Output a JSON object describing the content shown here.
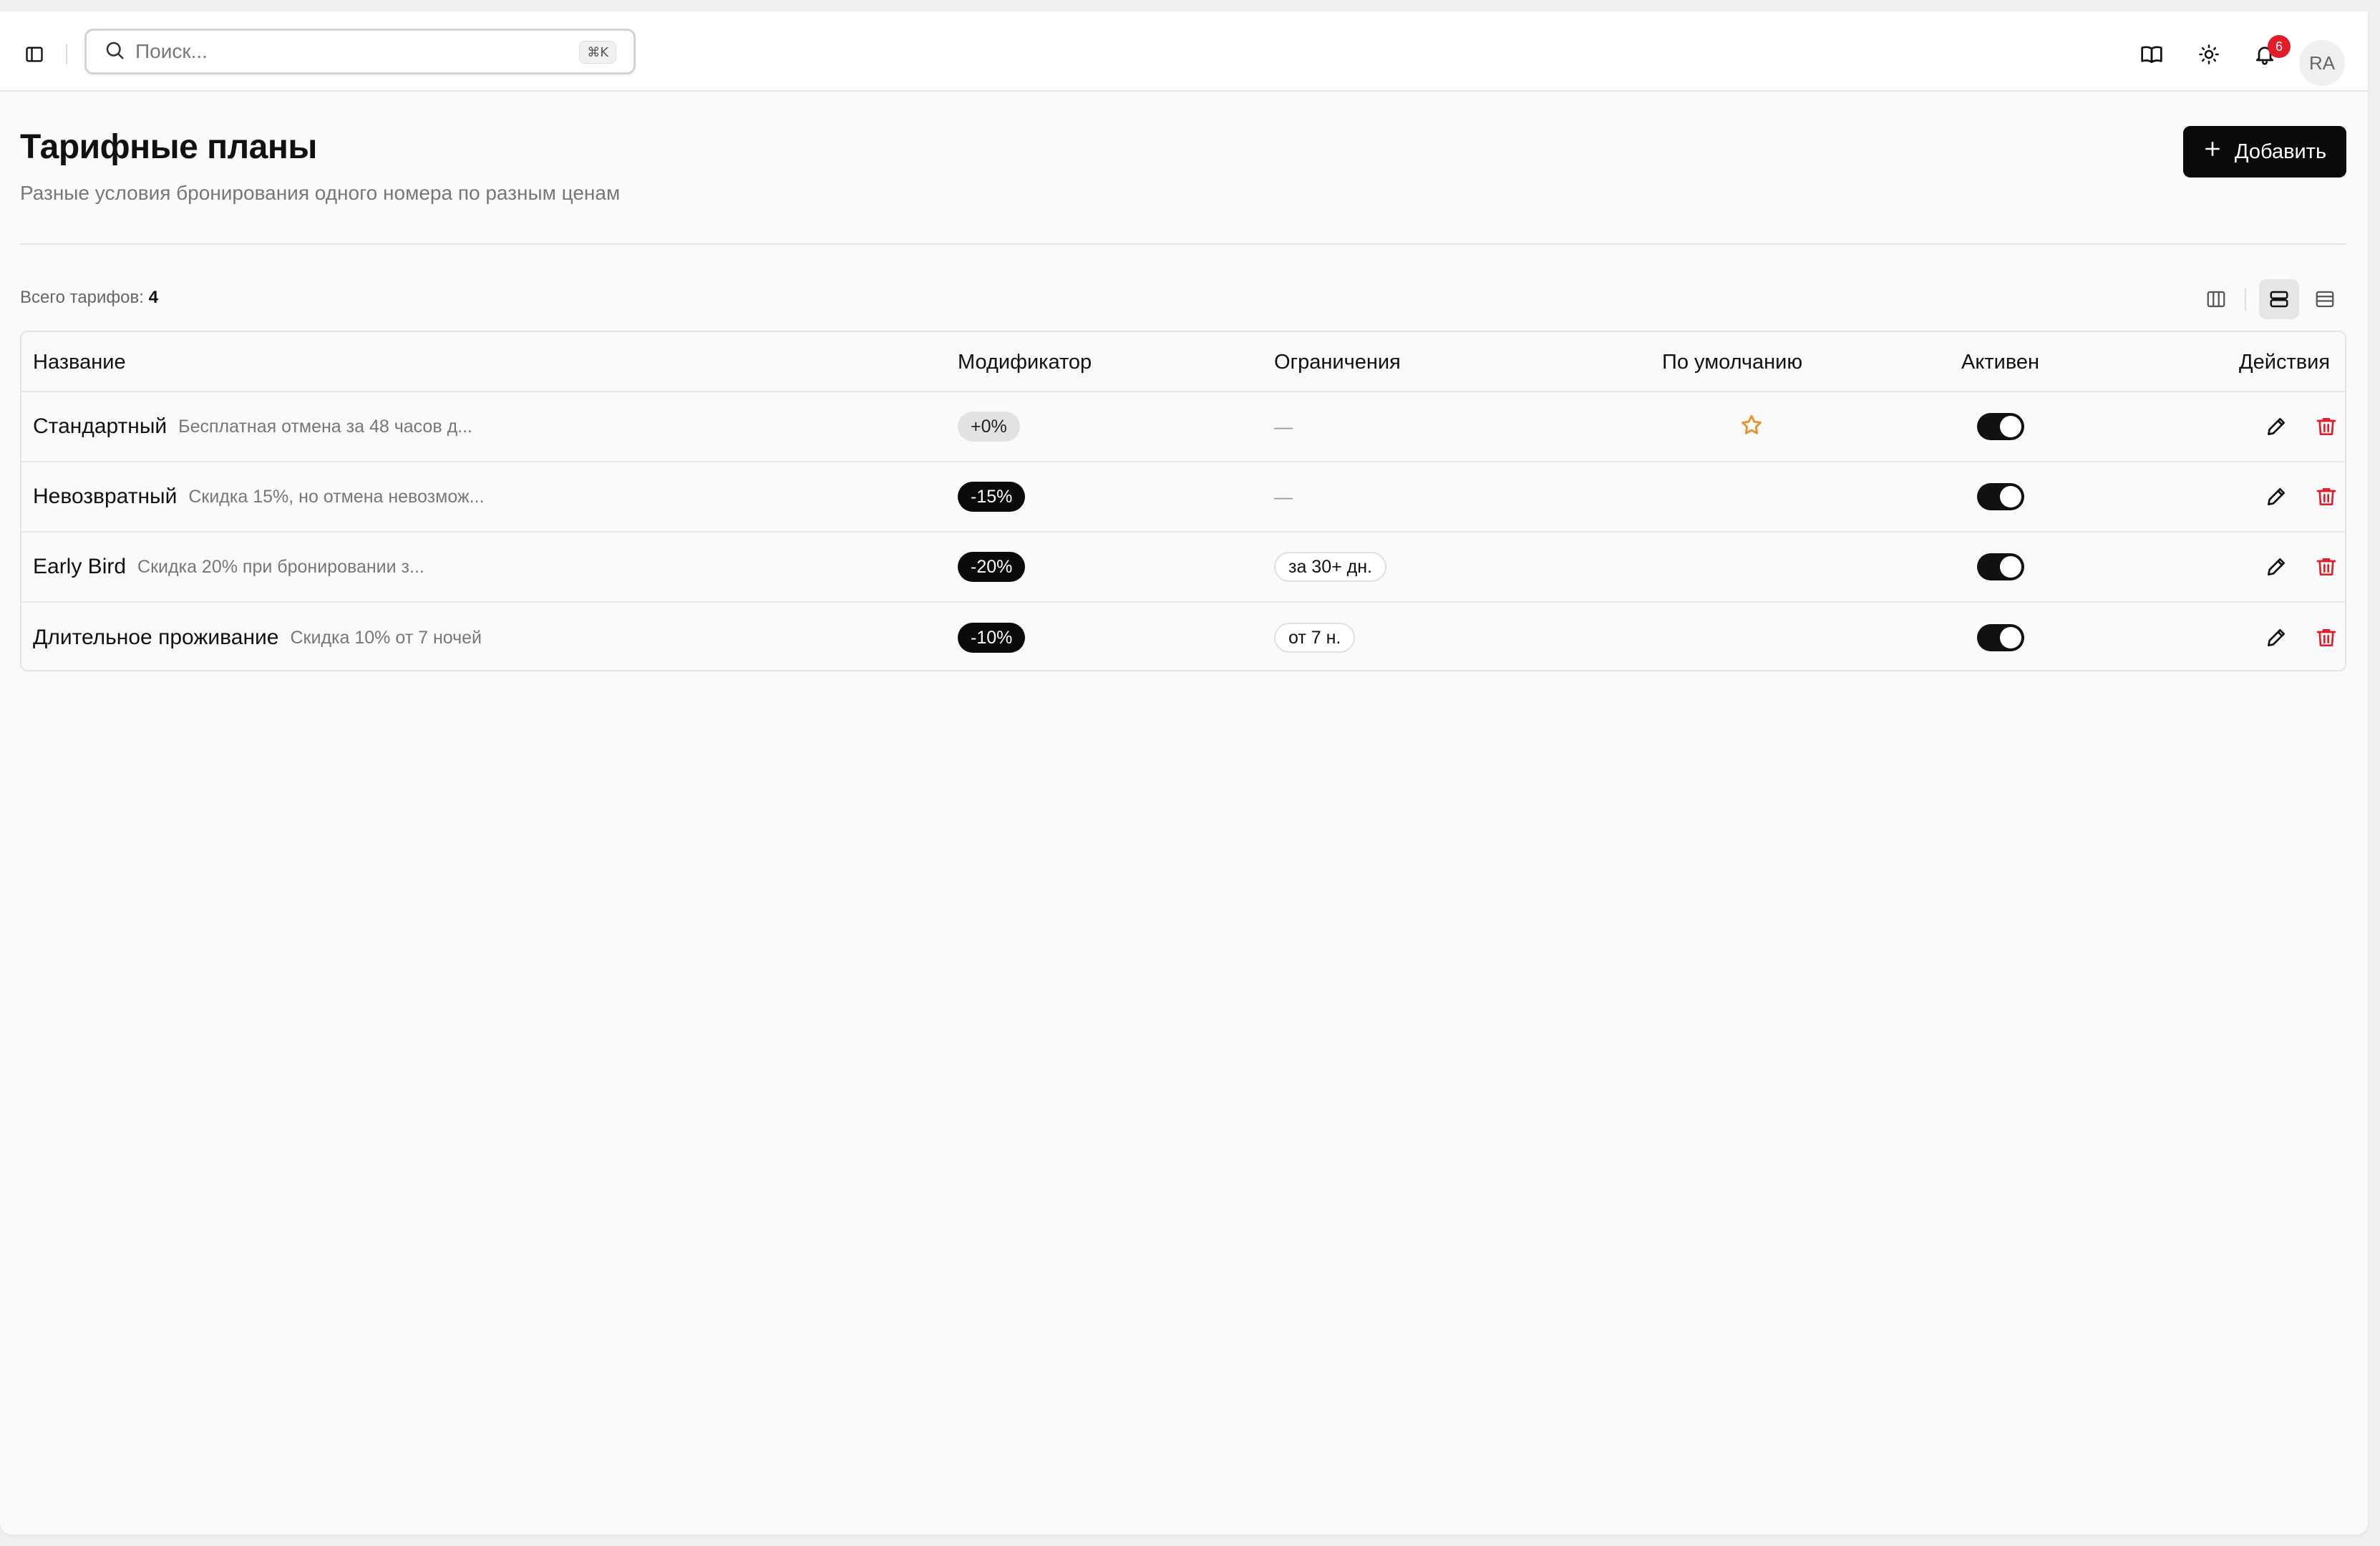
{
  "search": {
    "placeholder": "Поиск...",
    "shortcut": "⌘K"
  },
  "topbar": {
    "icons": [
      "sidebar-toggle-icon",
      "book-icon",
      "sun-icon",
      "bell-icon"
    ],
    "notifications_count": "6",
    "user_initials": "RA"
  },
  "header": {
    "title": "Тарифные планы",
    "subtitle": "Разные условия бронирования одного номера по разным ценам",
    "add_label": "Добавить"
  },
  "toolbar": {
    "total_label": "Всего тарифов:",
    "total_count": "4",
    "view_modes": [
      "columns-view-icon",
      "cards-view-icon",
      "table-view-icon"
    ],
    "active_view": "cards-view-icon"
  },
  "table": {
    "columns": [
      "Название",
      "Модификатор",
      "Ограничения",
      "По умолчанию",
      "Активен",
      "Действия"
    ],
    "rows": [
      {
        "name": "Стандартный",
        "description": "Бесплатная отмена за 48 часов д...",
        "modifier": "+0%",
        "modifier_style": "neutral",
        "restriction": "—",
        "is_default": true,
        "active": true
      },
      {
        "name": "Невозвратный",
        "description": "Скидка 15%, но отмена невозмож...",
        "modifier": "-15%",
        "modifier_style": "dark",
        "restriction": "—",
        "is_default": false,
        "active": true
      },
      {
        "name": "Early Bird",
        "description": "Скидка 20% при бронировании з...",
        "modifier": "-20%",
        "modifier_style": "dark",
        "restriction": "за 30+ дн.",
        "is_default": false,
        "active": true
      },
      {
        "name": "Длительное проживание",
        "description": "Скидка 10% от 7 ночей",
        "modifier": "-10%",
        "modifier_style": "dark",
        "restriction": "от 7 н.",
        "is_default": false,
        "active": true
      }
    ]
  },
  "colors": {
    "accent": "#0a0a0a",
    "star": "#e8912d",
    "danger": "#e11d2a",
    "badge": "#e11d2a"
  }
}
